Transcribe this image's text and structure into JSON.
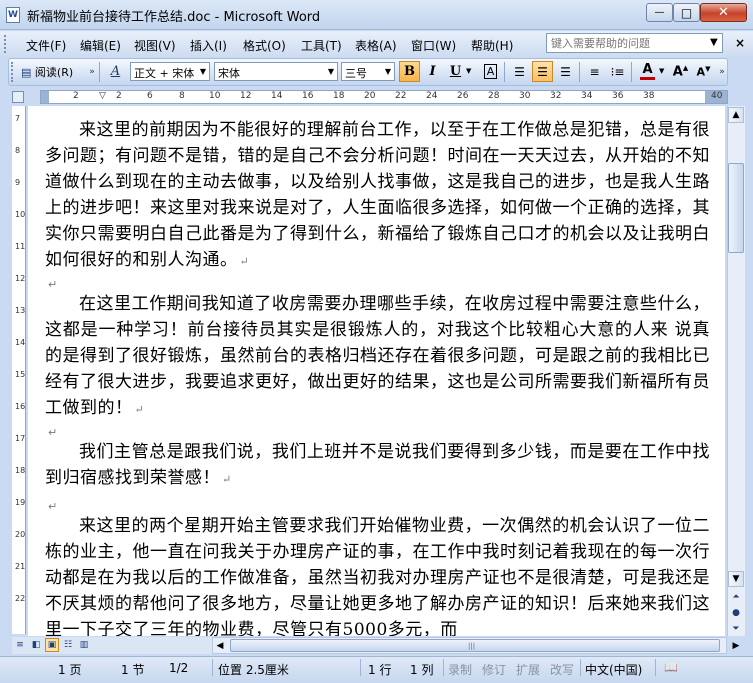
{
  "window": {
    "title": "新福物业前台接待工作总结.doc - Microsoft Word",
    "app_icon": "W",
    "minimize": "—",
    "maximize": "□",
    "close": "✕"
  },
  "menu": {
    "items": [
      "文件(F)",
      "编辑(E)",
      "视图(V)",
      "插入(I)",
      "格式(O)",
      "工具(T)",
      "表格(A)",
      "窗口(W)",
      "帮助(H)"
    ],
    "help_placeholder": "键入需要帮助的问题",
    "close_doc": "×"
  },
  "toolbar": {
    "reading_label": "阅读(R)",
    "style_value": "正文 + 宋体",
    "font_value": "宋体",
    "size_value": "三号",
    "bold": "B",
    "italic": "I",
    "underline": "U",
    "border_a": "A",
    "font_color_a": "A",
    "grow_font": "A",
    "shrink_font": "A",
    "accent_color": "#f7b44a",
    "font_color": "#c00000"
  },
  "ruler": {
    "h_numbers": [
      "2",
      "2",
      "4",
      "6",
      "8",
      "10",
      "12",
      "14",
      "16",
      "18",
      "20",
      "22",
      "24",
      "26",
      "28",
      "30",
      "32",
      "34",
      "36",
      "38",
      "40"
    ],
    "v_numbers": [
      "7",
      "8",
      "9",
      "10",
      "11",
      "12",
      "13",
      "14",
      "15",
      "16",
      "17",
      "18",
      "19",
      "20",
      "21",
      "22"
    ]
  },
  "document": {
    "paragraphs": [
      "来这里的前期因为不能很好的理解前台工作，以至于在工作做总是犯错，总是有很多问题；有问题不是错，错的是自己不会分析问题！时间在一天天过去，从开始的不知道做什么到现在的主动去做事，以及给别人找事做，这是我自己的进步，也是我人生路上的进步吧！来这里对我来说是对了，人生面临很多选择，如何做一个正确的选择，其实你只需要明白自己此番是为了得到什么，新福给了锻炼自己口才的机会以及让我明白如何很好的和别人沟通。",
      "在这里工作期间我知道了收房需要办理哪些手续，在收房过程中需要注意些什么，这都是一种学习！前台接待员其实是很锻炼人的，对我这个比较粗心大意的人来 说真的是得到了很好锻炼，虽然前台的表格归档还存在着很多问题，可是跟之前的我相比已经有了很大进步，我要追求更好，做出更好的结果，这也是公司所需要我们新福所有员工做到的！",
      "我们主管总是跟我们说，我们上班并不是说我们要得到多少钱，而是要在工作中找到归宿感找到荣誉感！",
      "来这里的两个星期开始主管要求我们开始催物业费，一次偶然的机会认识了一位二栋的业主，他一直在问我关于办理房产证的事，在工作中我时刻记着我现在的每一次行动都是在为我以后的工作做准备，虽然当初我对办理房产证也不是很清楚，可是我还是不厌其烦的帮他问了很多地方，尽量让她更多地了解办房产证的知识！后来她来我们这里一下子交了三年的物业费，尽管只有5000多元，而"
    ],
    "paragraph_mark": "↵"
  },
  "statusbar": {
    "page": "1 页",
    "section": "1 节",
    "page_of": "1/2",
    "position": "位置 2.5厘米",
    "line": "1 行",
    "column": "1 列",
    "rec": "录制",
    "trk": "修订",
    "ext": "扩展",
    "ovr": "改写",
    "language": "中文(中国)"
  }
}
